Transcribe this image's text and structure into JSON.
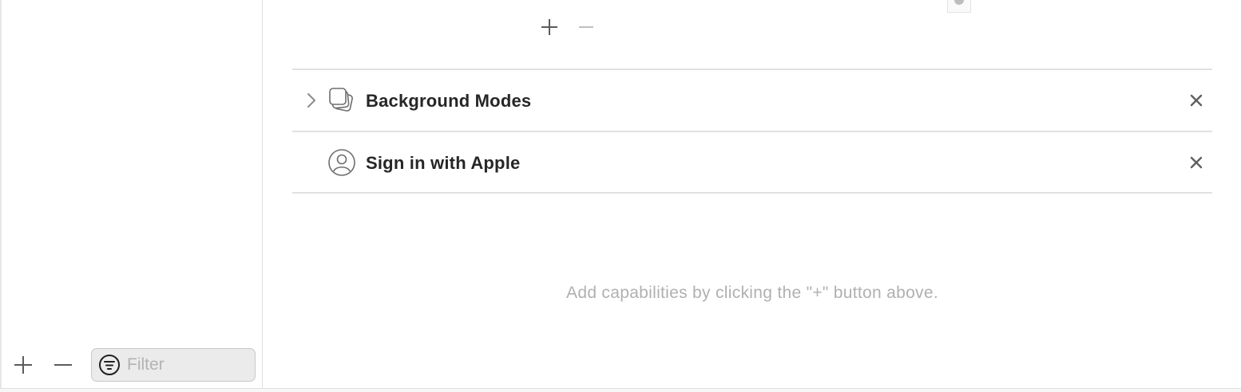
{
  "sidebar": {
    "add_icon": "plus-icon",
    "remove_icon": "minus-icon",
    "filter": {
      "icon": "filter-icon",
      "placeholder": "Filter",
      "value": ""
    }
  },
  "main": {
    "toolbar": {
      "add_icon": "plus-icon",
      "remove_icon": "minus-icon"
    },
    "capabilities": [
      {
        "title": "Background Modes",
        "icon": "stacked-squares-icon",
        "expandable": true,
        "remove_icon": "close-icon"
      },
      {
        "title": "Sign in with Apple",
        "icon": "person-circle-icon",
        "expandable": false,
        "remove_icon": "close-icon"
      }
    ],
    "hint": "Add capabilities by clicking the \"+\" button above."
  },
  "colors": {
    "text_primary": "#262626",
    "text_secondary": "#b0b0b0",
    "separator": "#e1e1e1",
    "icon_gray": "#8a8a8a"
  }
}
